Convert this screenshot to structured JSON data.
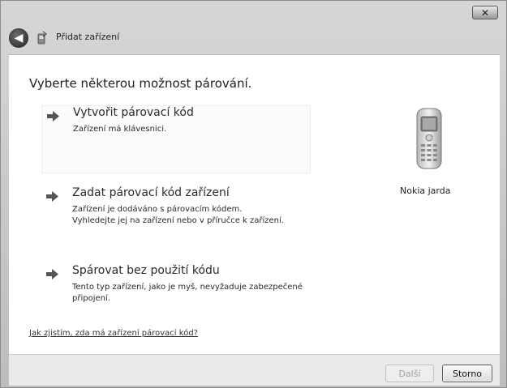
{
  "window": {
    "title": "Přidat zařízení",
    "close_label": "✕",
    "back_label": "◀"
  },
  "main": {
    "heading": "Vyberte některou možnost párování.",
    "options": [
      {
        "title": "Vytvořit párovací kód",
        "desc": "Zařízení má klávesnici."
      },
      {
        "title": "Zadat párovací kód zařízení",
        "desc": "Zařízení je dodáváno s párovacím kódem.\nVyhledejte jej na zařízení nebo v příručce k zařízení."
      },
      {
        "title": "Spárovat bez použití kódu",
        "desc": "Tento typ zařízení, jako je myš, nevyžaduje zabezpečené připojení."
      }
    ],
    "help_link": "Jak zjistím, zda má zařízení párovací kód?",
    "device": {
      "name": "Nokia jarda",
      "icon": "mobile-phone-icon"
    }
  },
  "footer": {
    "next_label": "Další",
    "cancel_label": "Storno"
  }
}
